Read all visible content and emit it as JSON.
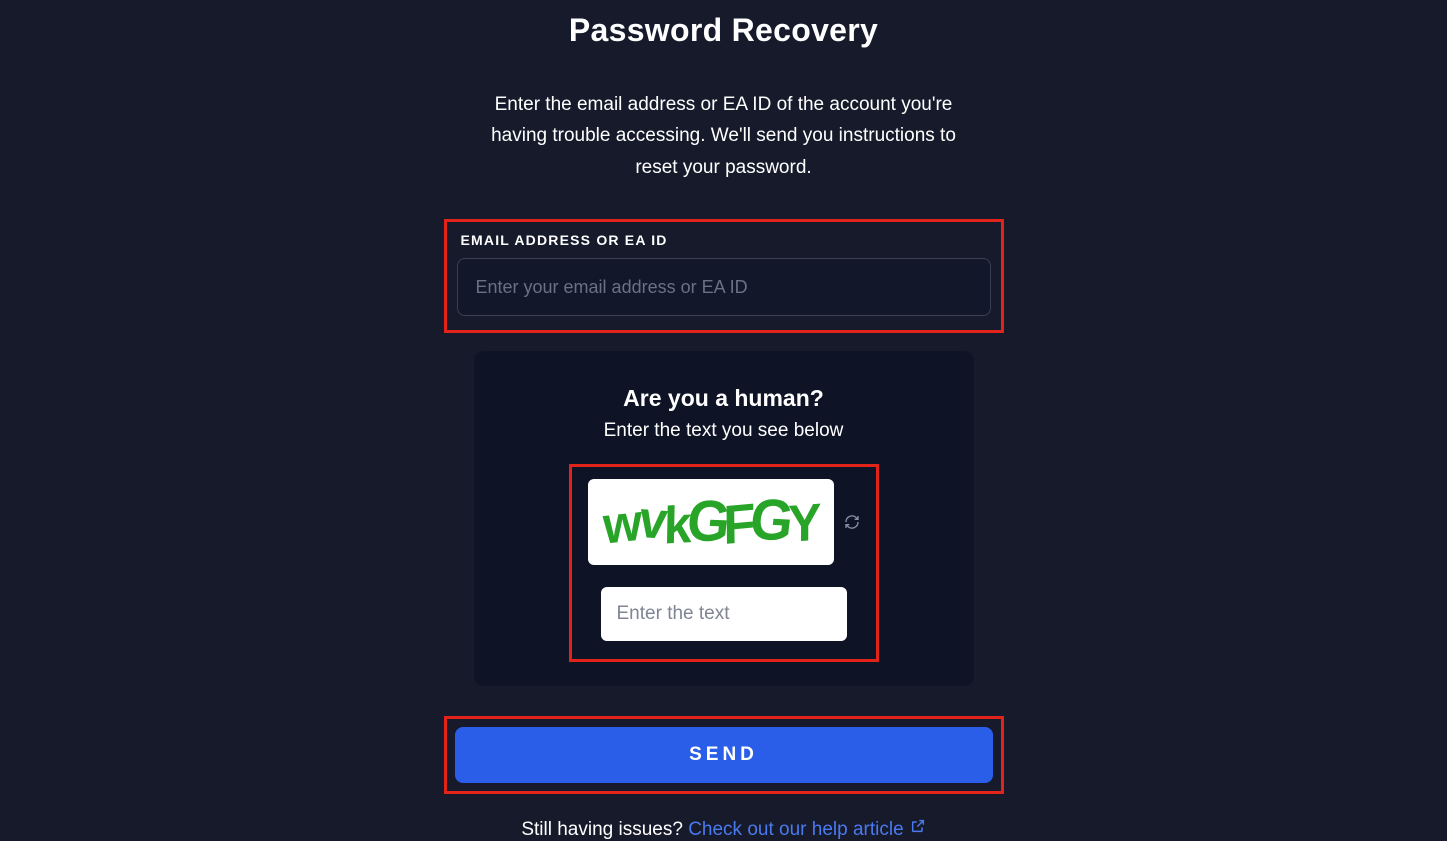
{
  "header": {
    "title": "Password Recovery",
    "description": "Enter the email address or EA ID of the account you're having trouble accessing. We'll send you instructions to reset your password."
  },
  "emailField": {
    "label": "EMAIL ADDRESS OR EA ID",
    "placeholder": "Enter your email address or EA ID",
    "value": ""
  },
  "captcha": {
    "title": "Are you a human?",
    "subtitle": "Enter the text you see below",
    "image_text": "wvkGFGY",
    "input_placeholder": "Enter the text",
    "input_value": "",
    "refresh_icon": "refresh-icon"
  },
  "actions": {
    "send_label": "SEND"
  },
  "help": {
    "prefix": "Still having issues? ",
    "link_text": "Check out our help article",
    "external_icon": "external-link-icon"
  },
  "annotations": {
    "highlight_color": "#e2231a"
  }
}
